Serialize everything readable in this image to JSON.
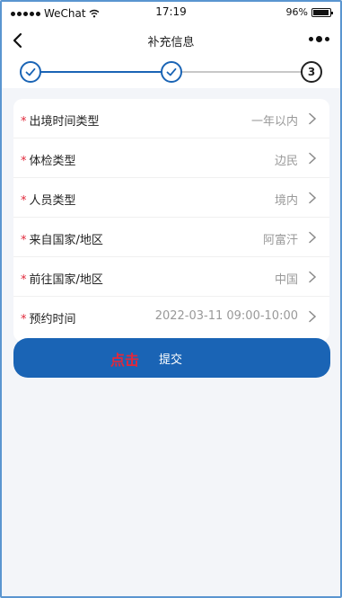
{
  "statusbar": {
    "carrier": "WeChat",
    "time": "17:19",
    "battery": "96%",
    "battery_level": 0.96
  },
  "navbar": {
    "title": "补充信息",
    "back_icon": "chevron-left-icon",
    "more_icon": "more-dots-icon"
  },
  "steps": {
    "completed_icon": "check-icon",
    "current_number": "3"
  },
  "form": {
    "rows": [
      {
        "required": "*",
        "label": "出境时间类型",
        "value": "一年以内"
      },
      {
        "required": "*",
        "label": "体检类型",
        "value": "边民"
      },
      {
        "required": "*",
        "label": "人员类型",
        "value": "境内"
      },
      {
        "required": "*",
        "label": "来自国家/地区",
        "value": "阿富汗"
      },
      {
        "required": "*",
        "label": "前往国家/地区",
        "value": "中国"
      },
      {
        "required": "*",
        "label": "预约时间",
        "value": "2022-03-11 09:00-10:00"
      }
    ]
  },
  "submit": {
    "click_word": "点击",
    "label": "提交"
  },
  "colors": {
    "primary": "#1a64b5",
    "required": "#e0283a",
    "click_word": "#e2283b",
    "frame_border": "#5a95d0"
  }
}
